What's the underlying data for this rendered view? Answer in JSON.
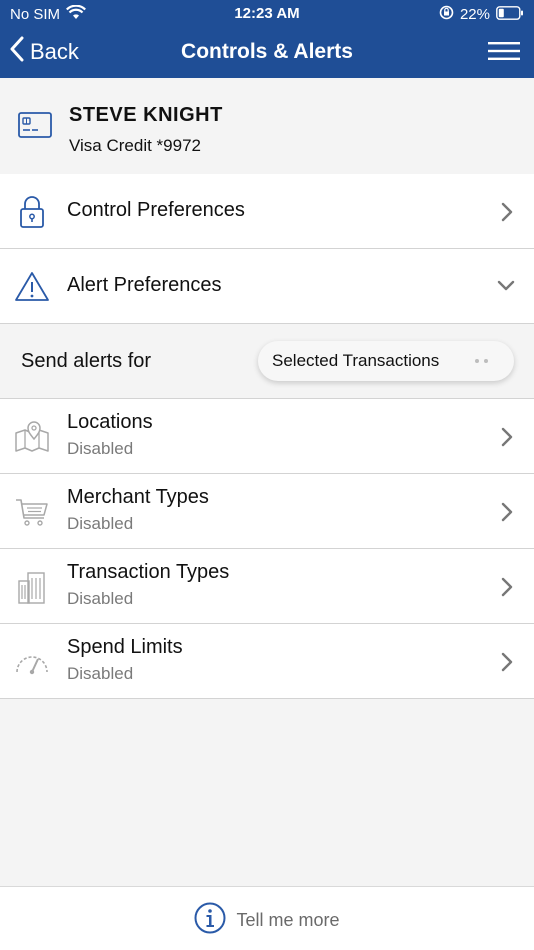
{
  "status_bar": {
    "carrier": "No SIM",
    "time": "12:23 AM",
    "battery": "22%"
  },
  "nav": {
    "back_label": "Back",
    "title": "Controls & Alerts",
    "menu_icon": "hamburger-menu-icon"
  },
  "card": {
    "holder": "STEVE KNIGHT",
    "description": "Visa Credit *9972",
    "icon": "credit-card-icon"
  },
  "sections": {
    "control": {
      "label": "Control Preferences",
      "icon": "lock-icon"
    },
    "alert": {
      "label": "Alert Preferences",
      "icon": "warning-triangle-icon",
      "expanded": true
    }
  },
  "alerts": {
    "label": "Send alerts for",
    "selected": "Selected Transactions"
  },
  "alert_items": [
    {
      "label": "Locations",
      "status": "Disabled",
      "icon": "map-pin-icon"
    },
    {
      "label": "Merchant Types",
      "status": "Disabled",
      "icon": "shopping-cart-icon"
    },
    {
      "label": "Transaction Types",
      "status": "Disabled",
      "icon": "buildings-icon"
    },
    {
      "label": "Spend Limits",
      "status": "Disabled",
      "icon": "speedometer-icon"
    }
  ],
  "footer": {
    "label": "Tell me more",
    "icon": "info-icon"
  },
  "colors": {
    "brand": "#1f4e96",
    "icon_blue": "#2a5aa8",
    "muted": "#7a7a7a"
  }
}
